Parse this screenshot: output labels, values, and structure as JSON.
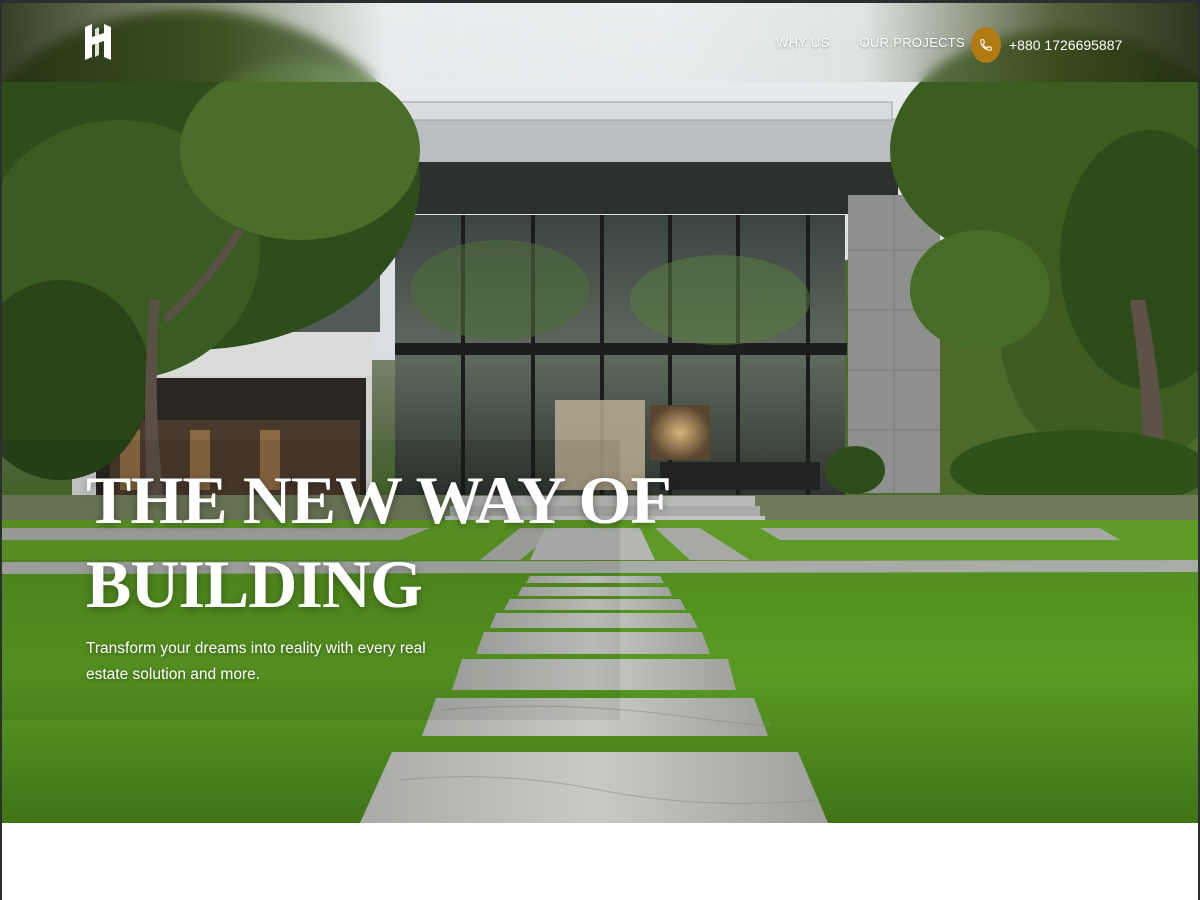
{
  "nav": {
    "logo_icon": "h-monogram-logo",
    "links": [
      "WHY US",
      "OUR PROJECTS"
    ],
    "phone_icon": "phone-icon",
    "phone": "+880 1726695887",
    "accent_color": "#b17a12"
  },
  "hero": {
    "headline_line1": "THE NEW WAY OF",
    "headline_line2": "BUILDING",
    "subtext": "Transform your dreams into reality with every real estate solution and more."
  }
}
